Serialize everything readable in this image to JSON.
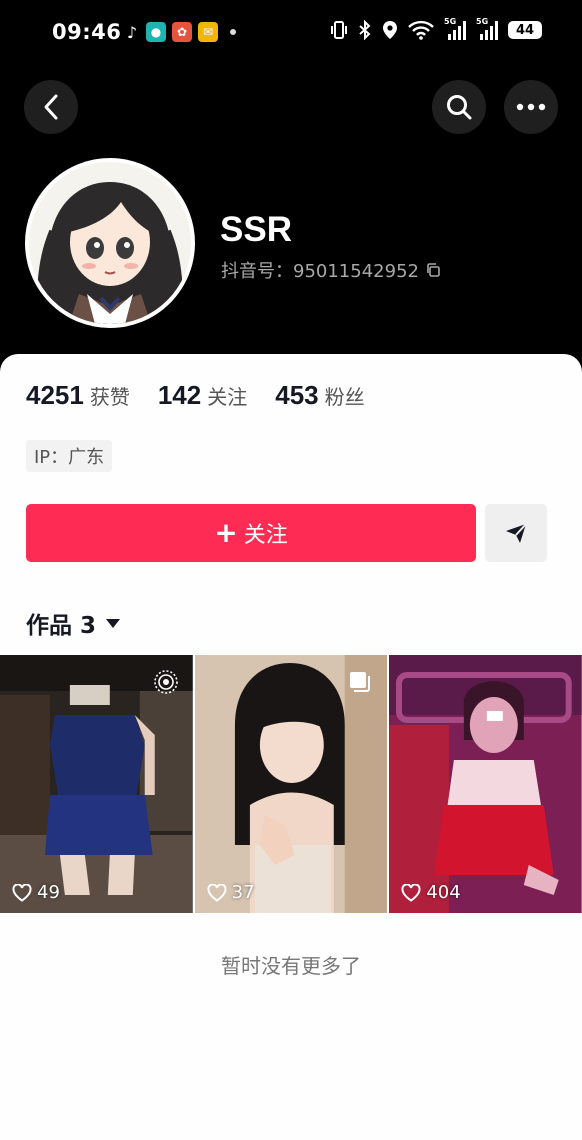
{
  "status_bar": {
    "time": "09:46",
    "notification_icons": [
      "tiktok-icon",
      "app-teal-icon",
      "app-red-icon",
      "app-yellow-icon",
      "dot-icon"
    ],
    "system_icons": [
      "vibrate-icon",
      "bluetooth-icon",
      "location-icon",
      "wifi-icon",
      "signal-5g-icon",
      "signal-5g-icon"
    ],
    "signal_label": "5G",
    "battery": "44"
  },
  "header": {
    "username": "SSR",
    "douyin_id": "抖音号：95011542952"
  },
  "stats": [
    {
      "num": "4251",
      "label": "获赞"
    },
    {
      "num": "142",
      "label": "关注"
    },
    {
      "num": "453",
      "label": "粉丝"
    }
  ],
  "ip_tag": "IP：广东",
  "actions": {
    "follow_label": "关注",
    "follow_plus": "+"
  },
  "works": {
    "tab_label": "作品 3"
  },
  "posts": [
    {
      "likes": "49"
    },
    {
      "likes": "37"
    },
    {
      "likes": "404"
    }
  ],
  "footer_note": "暂时没有更多了",
  "colors": {
    "accent": "#fe2c55",
    "header_bg": "#000000",
    "page_bg": "#fefefe"
  }
}
